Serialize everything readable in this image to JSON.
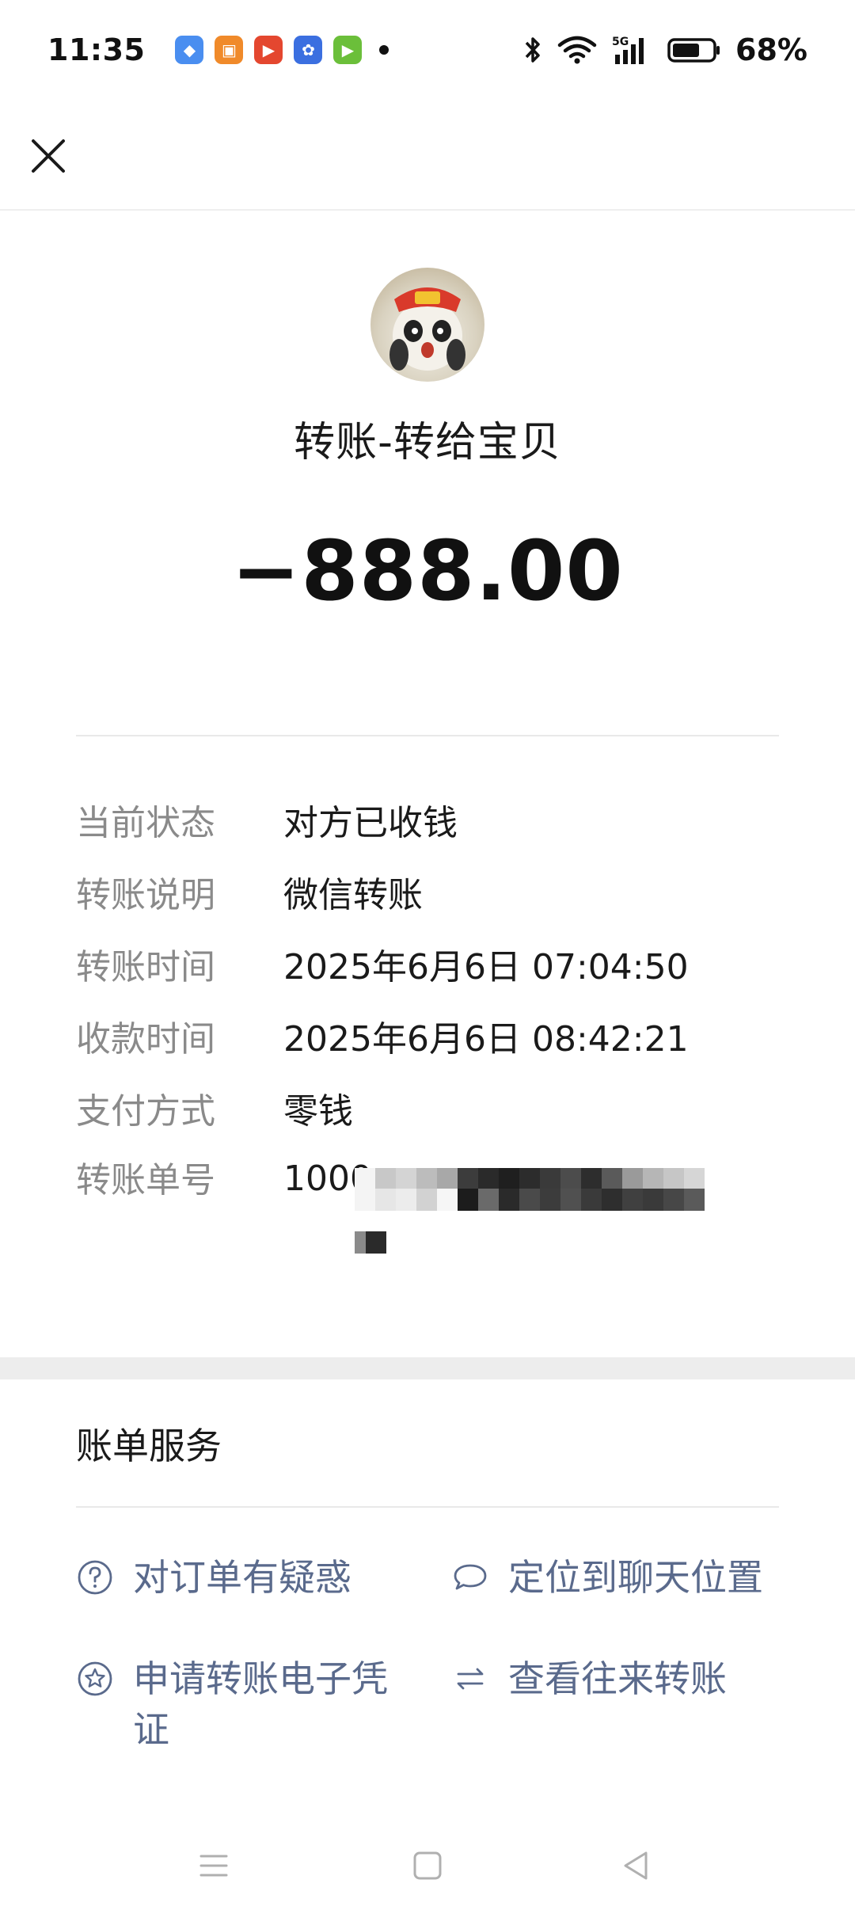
{
  "status_bar": {
    "time": "11:35",
    "apps": [
      {
        "icon": "blue-app-icon",
        "color": "#4a8ef0",
        "glyph": "◆"
      },
      {
        "icon": "orange-app-icon",
        "color": "#f08a2a",
        "glyph": "▣"
      },
      {
        "icon": "video-app-icon",
        "color": "#e4472f",
        "glyph": "▶"
      },
      {
        "icon": "baidu-app-icon",
        "color": "#3b6fe0",
        "glyph": "✿"
      },
      {
        "icon": "game-app-icon",
        "color": "#6bbf3a",
        "glyph": "▶"
      }
    ],
    "network": "5G",
    "battery": "68%",
    "battery_level": 0.68
  },
  "header": {
    "close_icon": "close-icon"
  },
  "summary": {
    "title": "转账-转给宝贝",
    "amount": "−888.00"
  },
  "details": [
    {
      "label": "当前状态",
      "value": "对方已收钱"
    },
    {
      "label": "转账说明",
      "value": "微信转账"
    },
    {
      "label": "转账时间",
      "value": "2025年6月6日 07:04:50"
    },
    {
      "label": "收款时间",
      "value": "2025年6月6日 08:42:21"
    },
    {
      "label": "支付方式",
      "value": "零钱"
    }
  ],
  "order": {
    "label": "转账单号",
    "value_visible": "1000"
  },
  "bill_service": {
    "title": "账单服务",
    "items": [
      {
        "label": "对订单有疑惑",
        "icon": "question-circle-icon"
      },
      {
        "label": "定位到聊天位置",
        "icon": "chat-bubble-icon"
      },
      {
        "label": "申请转账电子凭证",
        "icon": "star-circle-icon"
      },
      {
        "label": "查看往来转账",
        "icon": "swap-arrows-icon"
      }
    ]
  },
  "navbar": {
    "icons": [
      "menu-icon",
      "home-square-icon",
      "back-triangle-icon"
    ]
  },
  "colors": {
    "link": "#5a6a8c",
    "label_gray": "#8a8a8a",
    "divider": "#e9e9e9"
  }
}
